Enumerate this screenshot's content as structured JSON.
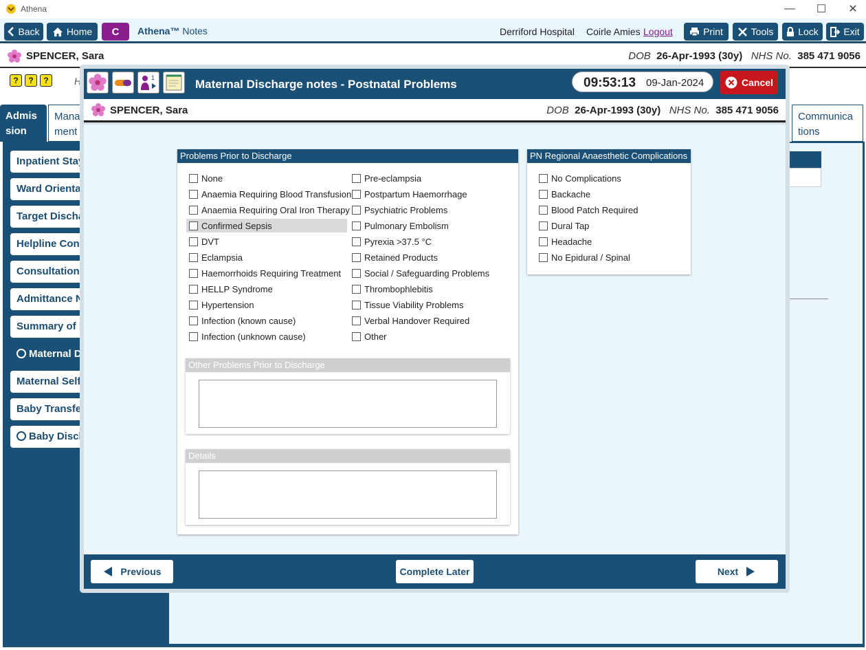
{
  "window": {
    "title": "Athena",
    "minimize": "—",
    "maximize": "☐",
    "close": "✕"
  },
  "toolbar": {
    "back": "Back",
    "home": "Home",
    "c_badge": "C",
    "brand_name": "Athena™",
    "brand_suffix": "Notes",
    "hospital": "Derriford Hospital",
    "user": "Coirle Amies",
    "logout": "Logout",
    "print": "Print",
    "tools": "Tools",
    "lock": "Lock",
    "exit": "Exit"
  },
  "patient": {
    "name": "SPENCER, Sara",
    "dob_label": "DOB",
    "dob": "26-Apr-1993 (30y)",
    "nhs_label": "NHS No.",
    "nhs": "385 471 9056"
  },
  "background": {
    "h_label": "H",
    "tabs": [
      {
        "label": "Admis sion"
      },
      {
        "label": "Mana ment"
      },
      {
        "label": "Communica tions"
      }
    ],
    "sidebar": [
      {
        "label": "Inpatient Stay"
      },
      {
        "label": "Ward Orientat"
      },
      {
        "label": "Target Dischar"
      },
      {
        "label": "Helpline Cont"
      },
      {
        "label": "Consultation I"
      },
      {
        "label": "Admittance N"
      },
      {
        "label": "Summary of P"
      },
      {
        "label": "Maternal Di"
      },
      {
        "label": "Maternal Self"
      },
      {
        "label": "Baby Transfer"
      },
      {
        "label": "Baby Discha"
      }
    ]
  },
  "modal": {
    "title": "Maternal Discharge notes - Postnatal Problems",
    "time": "09:53:13",
    "date": "09-Jan-2024",
    "cancel": "Cancel",
    "problems": {
      "header": "Problems Prior to Discharge",
      "left": [
        "None",
        "Anaemia Requiring Blood Transfusion",
        "Anaemia Requiring Oral Iron Therapy",
        "Confirmed Sepsis",
        "DVT",
        "Eclampsia",
        "Haemorrhoids Requiring Treatment",
        "HELLP Syndrome",
        "Hypertension",
        "Infection (known cause)",
        "Infection (unknown cause)"
      ],
      "right": [
        "Pre-eclampsia",
        "Postpartum Haemorrhage",
        "Psychiatric Problems",
        "Pulmonary Embolism",
        "Pyrexia >37.5 °C",
        "Retained Products",
        "Social / Safeguarding Problems",
        "Thrombophlebitis",
        "Tissue Viability Problems",
        "Verbal Handover Required",
        "Other"
      ],
      "other_header": "Other Problems Prior to Discharge",
      "other_value": "",
      "details_header": "Details",
      "details_value": ""
    },
    "anaesthetic": {
      "header": "PN Regional Anaesthetic Complications",
      "items": [
        "No Complications",
        "Backache",
        "Blood Patch Required",
        "Dural Tap",
        "Headache",
        "No Epidural / Spinal"
      ]
    },
    "footer": {
      "previous": "Previous",
      "complete_later": "Complete Later",
      "next": "Next"
    }
  }
}
